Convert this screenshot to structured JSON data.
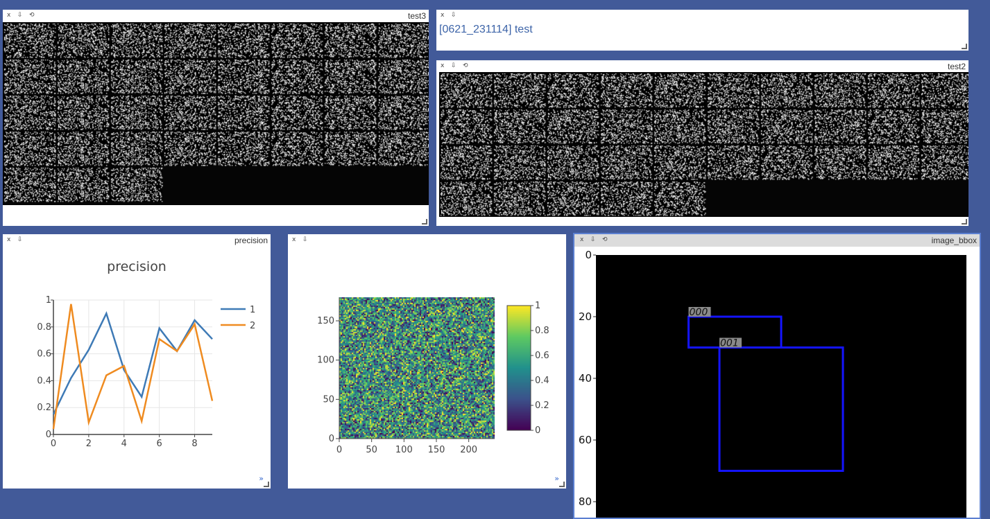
{
  "colors": {
    "background": "#425a99",
    "pane": "#ffffff",
    "title_bar_active": "#dcdcdc",
    "series_1": "#3e7ab6",
    "series_2": "#ef8b20",
    "bbox": "#1414ff"
  },
  "controls": {
    "close": "x",
    "pin": "⇩",
    "refresh": "⟲",
    "expand": "»"
  },
  "panes": {
    "test3": {
      "title": "test3",
      "grid_cols": 8,
      "grid_rows": 5,
      "filled_tiles": 35
    },
    "text": {
      "content": "[0621_231114] test"
    },
    "test2": {
      "title": "test2",
      "grid_cols": 10,
      "grid_rows": 4,
      "filled_tiles": 35
    },
    "precision": {
      "title": "precision"
    },
    "heatmap": {
      "title": ""
    },
    "image_bbox": {
      "title": "image_bbox"
    }
  },
  "chart_data": [
    {
      "type": "line",
      "title": "precision",
      "x": [
        0,
        1,
        2,
        3,
        4,
        5,
        6,
        7,
        8,
        9
      ],
      "series": [
        {
          "name": "1",
          "values": [
            0.15,
            0.42,
            0.63,
            0.9,
            0.48,
            0.28,
            0.79,
            0.62,
            0.85,
            0.71
          ]
        },
        {
          "name": "2",
          "values": [
            0.04,
            0.97,
            0.09,
            0.44,
            0.51,
            0.1,
            0.71,
            0.62,
            0.82,
            0.25
          ]
        }
      ],
      "xlim": [
        0,
        9
      ],
      "ylim": [
        0,
        1
      ],
      "xticks": [
        "0",
        "2",
        "4",
        "6",
        "8"
      ],
      "yticks": [
        "0",
        "0.2",
        "0.4",
        "0.6",
        "0.8",
        "1"
      ],
      "grid": true,
      "legend": "right"
    },
    {
      "type": "heatmap",
      "colormap": "viridis",
      "xlim": [
        0,
        240
      ],
      "ylim": [
        0,
        180
      ],
      "xticks": [
        "0",
        "50",
        "100",
        "150",
        "200"
      ],
      "yticks": [
        "0",
        "50",
        "100",
        "150"
      ],
      "colorbar_ticks": [
        "0",
        "0.2",
        "0.4",
        "0.6",
        "0.8",
        "1"
      ]
    },
    {
      "type": "image",
      "yticks": [
        "0",
        "20",
        "40",
        "60",
        "80"
      ],
      "boxes": [
        {
          "label": "000",
          "x0": 30,
          "y0": 20,
          "x1": 60,
          "y1": 30
        },
        {
          "label": "001",
          "x0": 40,
          "y0": 30,
          "x1": 80,
          "y1": 70
        }
      ]
    }
  ]
}
